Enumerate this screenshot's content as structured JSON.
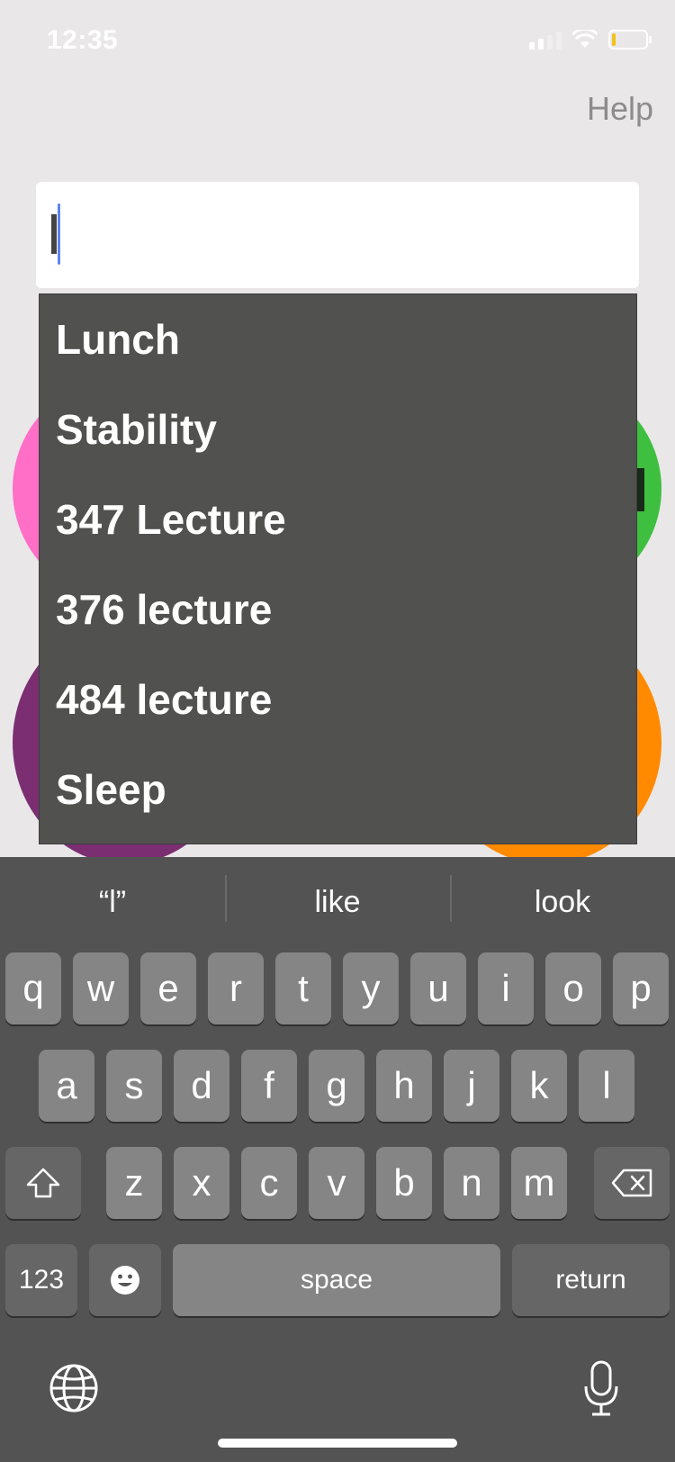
{
  "status_bar": {
    "time": "12:35"
  },
  "header": {
    "help_label": "Help"
  },
  "search": {
    "value": "",
    "placeholder": ""
  },
  "suggestions": [
    "Lunch",
    "Stability",
    "347 Lecture",
    "376 lecture",
    "484 lecture",
    "Sleep"
  ],
  "keyboard": {
    "predictions": [
      "“l”",
      "like",
      "look"
    ],
    "row1": [
      "q",
      "w",
      "e",
      "r",
      "t",
      "y",
      "u",
      "i",
      "o",
      "p"
    ],
    "row2": [
      "a",
      "s",
      "d",
      "f",
      "g",
      "h",
      "j",
      "k",
      "l"
    ],
    "row3": [
      "z",
      "x",
      "c",
      "v",
      "b",
      "n",
      "m"
    ],
    "numbers_label": "123",
    "space_label": "space",
    "return_label": "return"
  },
  "colors": {
    "circle_pink": "#ff6ec7",
    "circle_green": "#3fbf3f",
    "circle_purple": "#7b2f72",
    "circle_orange": "#ff8a00",
    "caret": "#5f84f0"
  }
}
